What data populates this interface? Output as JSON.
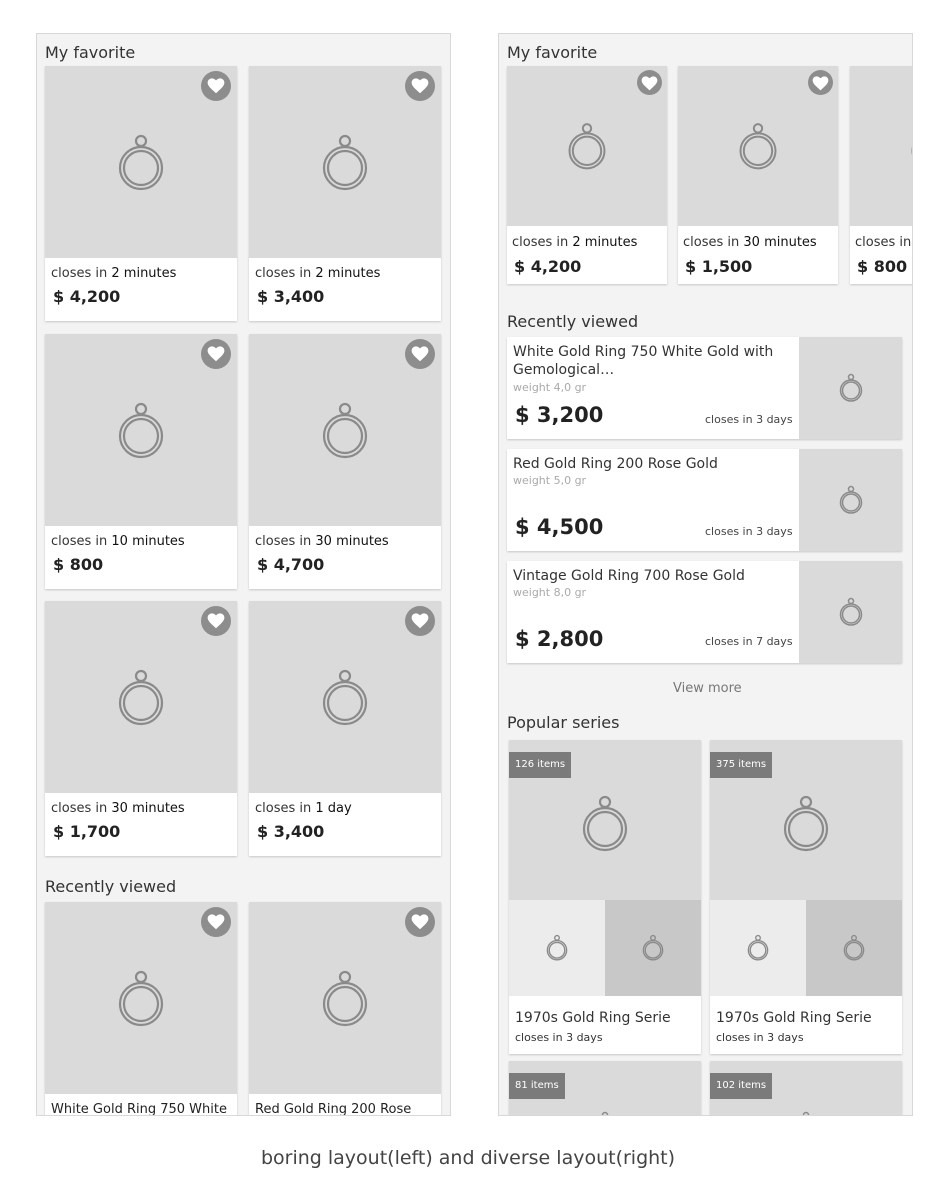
{
  "caption": "boring layout(left) and diverse layout(right)",
  "closes_in_prefix": "closes in",
  "left": {
    "favorites_title": "My favorite",
    "favorites": [
      {
        "time": "2 minutes",
        "price": "$ 4,200"
      },
      {
        "time": "2 minutes",
        "price": "$ 3,400"
      },
      {
        "time": "10 minutes",
        "price": "$ 800"
      },
      {
        "time": "30 minutes",
        "price": "$ 4,700"
      },
      {
        "time": "30 minutes",
        "price": "$ 1,700"
      },
      {
        "time": "1 day",
        "price": "$ 3,400"
      }
    ],
    "recent_title": "Recently viewed",
    "recent": [
      {
        "title": "White Gold Ring 750 White"
      },
      {
        "title": "Red Gold Ring 200 Rose"
      }
    ]
  },
  "right": {
    "favorites_title": "My favorite",
    "favorites": [
      {
        "time": "2 minutes",
        "price": "$ 4,200"
      },
      {
        "time": "30 minutes",
        "price": "$ 1,500"
      },
      {
        "time": "",
        "price": "$ 800"
      }
    ],
    "recent_title": "Recently viewed",
    "recent": [
      {
        "title_1": "White Gold Ring 750 White Gold with",
        "title_2": "Gemological…",
        "weight": "weight 4,0 gr",
        "price": "$ 3,200",
        "closes": "closes in 3 days"
      },
      {
        "title_1": "Red Gold Ring 200 Rose Gold",
        "title_2": "",
        "weight": "weight 5,0 gr",
        "price": "$ 4,500",
        "closes": "closes in 3 days"
      },
      {
        "title_1": "Vintage Gold Ring 700 Rose Gold",
        "title_2": "",
        "weight": "weight 8,0 gr",
        "price": "$ 2,800",
        "closes": "closes in 7 days"
      }
    ],
    "view_more": "View more",
    "popular_title": "Popular series",
    "series": [
      {
        "count": "126 items",
        "name": "1970s Gold Ring Serie",
        "closes": "closes in 3 days"
      },
      {
        "count": "375 items",
        "name": "1970s Gold Ring Serie",
        "closes": "closes in 3 days"
      },
      {
        "count": "81 items"
      },
      {
        "count": "102 items"
      }
    ]
  }
}
